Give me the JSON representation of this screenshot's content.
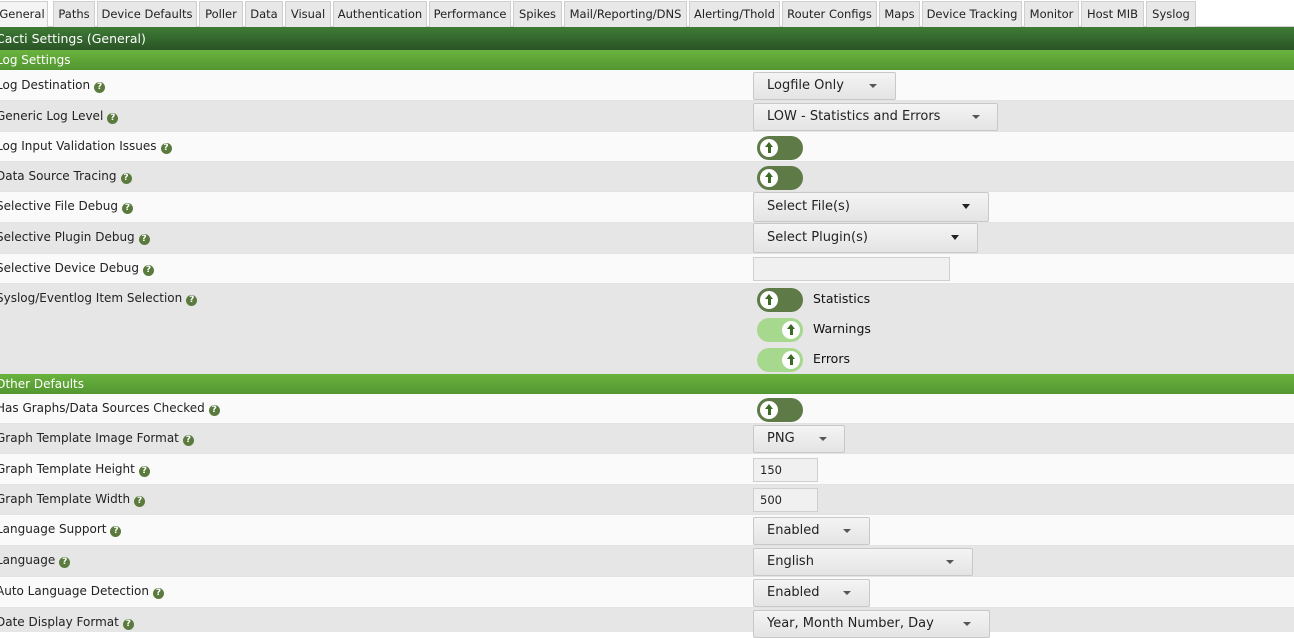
{
  "tabs": [
    "General",
    "Paths",
    "Device Defaults",
    "Poller",
    "Data",
    "Visual",
    "Authentication",
    "Performance",
    "Spikes",
    "Mail/Reporting/DNS",
    "Alerting/Thold",
    "Router Configs",
    "Maps",
    "Device Tracking",
    "Monitor",
    "Host MIB",
    "Syslog"
  ],
  "active_tab": "General",
  "title": "Cacti Settings (General)",
  "sections": {
    "log": "Log Settings",
    "other": "Other Defaults"
  },
  "help_icon": "?",
  "fields": {
    "log_destination": {
      "label": "Log Destination",
      "value": "Logfile Only"
    },
    "generic_log_level": {
      "label": "Generic Log Level",
      "value": "LOW - Statistics and Errors"
    },
    "log_input_validation": {
      "label": "Log Input Validation Issues"
    },
    "data_source_tracing": {
      "label": "Data Source Tracing"
    },
    "selective_file_debug": {
      "label": "Selective File Debug",
      "value": "Select File(s)"
    },
    "selective_plugin_debug": {
      "label": "Selective Plugin Debug",
      "value": "Select Plugin(s)"
    },
    "selective_device_debug": {
      "label": "Selective Device Debug",
      "value": ""
    },
    "syslog_item_selection": {
      "label": "Syslog/Eventlog Item Selection",
      "options": [
        "Statistics",
        "Warnings",
        "Errors"
      ]
    },
    "has_graphs_checked": {
      "label": "Has Graphs/Data Sources Checked"
    },
    "graph_image_format": {
      "label": "Graph Template Image Format",
      "value": "PNG"
    },
    "graph_height": {
      "label": "Graph Template Height",
      "value": "150"
    },
    "graph_width": {
      "label": "Graph Template Width",
      "value": "500"
    },
    "language_support": {
      "label": "Language Support",
      "value": "Enabled"
    },
    "language": {
      "label": "Language",
      "value": "English"
    },
    "auto_language": {
      "label": "Auto Language Detection",
      "value": "Enabled"
    },
    "date_format": {
      "label": "Date Display Format",
      "value": "Year, Month Number, Day"
    }
  },
  "colors": {
    "title_bar": "#33652f",
    "section_bar": "#5fa336",
    "toggle_off": "#5d7a47",
    "toggle_on": "#a6d88e"
  }
}
